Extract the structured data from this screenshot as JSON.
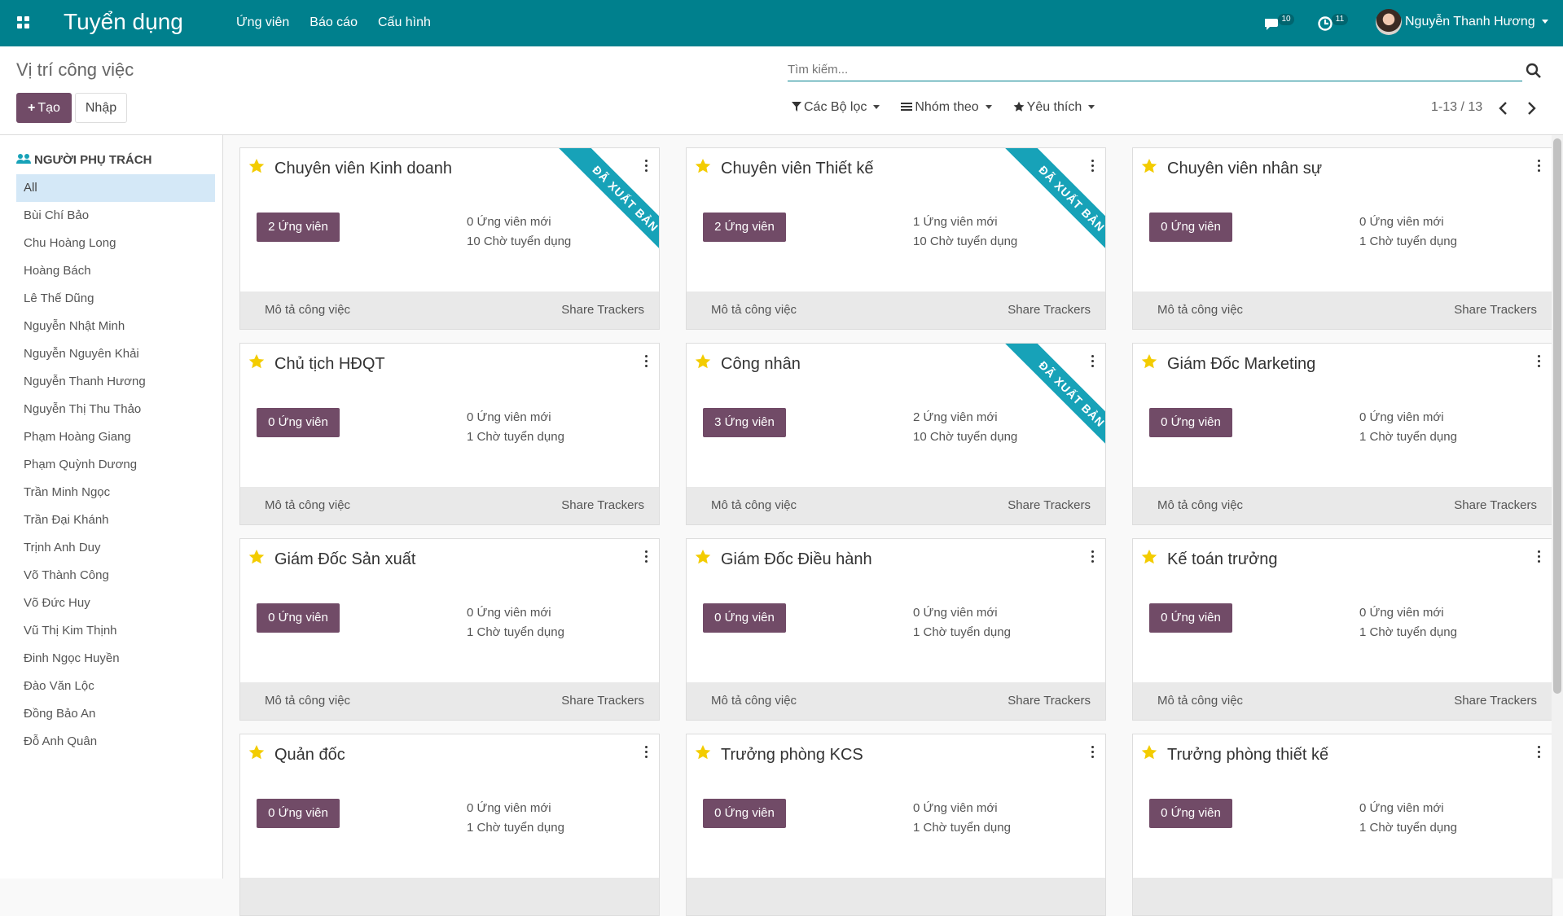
{
  "navbar": {
    "app_title": "Tuyển dụng",
    "menu": [
      "Ứng viên",
      "Báo cáo",
      "Cấu hình"
    ],
    "messages_count": "10",
    "activities_count": "11",
    "user_name": "Nguyễn Thanh Hương"
  },
  "control": {
    "page_title": "Vị trí công việc",
    "create_label": "Tạo",
    "import_label": "Nhập",
    "search_placeholder": "Tìm kiếm...",
    "filters_label": "Các Bộ lọc",
    "groupby_label": "Nhóm theo",
    "favorites_label": "Yêu thích",
    "pager": "1-13 / 13"
  },
  "sidebar": {
    "heading": "NGƯỜI PHỤ TRÁCH",
    "items": [
      "All",
      "Bùi Chí Bảo",
      "Chu Hoàng Long",
      "Hoàng Bách",
      "Lê Thế Dũng",
      "Nguyễn Nhật Minh",
      "Nguyễn Nguyên Khải",
      "Nguyễn Thanh Hương",
      "Nguyễn Thị Thu Thảo",
      "Phạm Hoàng Giang",
      "Phạm Quỳnh Dương",
      "Trần Minh Ngọc",
      "Trần Đại Khánh",
      "Trịnh Anh Duy",
      "Võ Thành Công",
      "Võ Đức Huy",
      "Vũ Thị Kim Thịnh",
      "Đinh Ngọc Huyền",
      "Đào Văn Lộc",
      "Đồng Bảo An",
      "Đỗ Anh Quân"
    ]
  },
  "cards": [
    {
      "title": "Chuyên viên Kinh doanh",
      "applicants": "2 Ứng viên",
      "new": "0 Ứng viên mới",
      "to_recruit": "10 Chờ tuyển dụng",
      "ribbon": "ĐÃ XUẤT BẢN",
      "desc": "Mô tả công việc",
      "share": "Share Trackers"
    },
    {
      "title": "Chuyên viên Thiết kế",
      "applicants": "2 Ứng viên",
      "new": "1 Ứng viên mới",
      "to_recruit": "10 Chờ tuyển dụng",
      "ribbon": "ĐÃ XUẤT BẢN",
      "desc": "Mô tả công việc",
      "share": "Share Trackers"
    },
    {
      "title": "Chuyên viên nhân sự",
      "applicants": "0 Ứng viên",
      "new": "0 Ứng viên mới",
      "to_recruit": "1 Chờ tuyển dụng",
      "ribbon": "",
      "desc": "Mô tả công việc",
      "share": "Share Trackers"
    },
    {
      "title": "Chủ tịch HĐQT",
      "applicants": "0 Ứng viên",
      "new": "0 Ứng viên mới",
      "to_recruit": "1 Chờ tuyển dụng",
      "ribbon": "",
      "desc": "Mô tả công việc",
      "share": "Share Trackers"
    },
    {
      "title": "Công nhân",
      "applicants": "3 Ứng viên",
      "new": "2 Ứng viên mới",
      "to_recruit": "10 Chờ tuyển dụng",
      "ribbon": "ĐÃ XUẤT BẢN",
      "desc": "Mô tả công việc",
      "share": "Share Trackers"
    },
    {
      "title": "Giám Đốc Marketing",
      "applicants": "0 Ứng viên",
      "new": "0 Ứng viên mới",
      "to_recruit": "1 Chờ tuyển dụng",
      "ribbon": "",
      "desc": "Mô tả công việc",
      "share": "Share Trackers"
    },
    {
      "title": "Giám Đốc Sản xuất",
      "applicants": "0 Ứng viên",
      "new": "0 Ứng viên mới",
      "to_recruit": "1 Chờ tuyển dụng",
      "ribbon": "",
      "desc": "Mô tả công việc",
      "share": "Share Trackers"
    },
    {
      "title": "Giám Đốc Điều hành",
      "applicants": "0 Ứng viên",
      "new": "0 Ứng viên mới",
      "to_recruit": "1 Chờ tuyển dụng",
      "ribbon": "",
      "desc": "Mô tả công việc",
      "share": "Share Trackers"
    },
    {
      "title": "Kế toán trưởng",
      "applicants": "0 Ứng viên",
      "new": "0 Ứng viên mới",
      "to_recruit": "1 Chờ tuyển dụng",
      "ribbon": "",
      "desc": "Mô tả công việc",
      "share": "Share Trackers"
    },
    {
      "title": "Quản đốc",
      "applicants": "0 Ứng viên",
      "new": "0 Ứng viên mới",
      "to_recruit": "1 Chờ tuyển dụng",
      "ribbon": "",
      "desc": "",
      "share": ""
    },
    {
      "title": "Trưởng phòng KCS",
      "applicants": "0 Ứng viên",
      "new": "0 Ứng viên mới",
      "to_recruit": "1 Chờ tuyển dụng",
      "ribbon": "",
      "desc": "",
      "share": ""
    },
    {
      "title": "Trưởng phòng thiết kế",
      "applicants": "0 Ứng viên",
      "new": "0 Ứng viên mới",
      "to_recruit": "1 Chờ tuyển dụng",
      "ribbon": "",
      "desc": "",
      "share": ""
    }
  ],
  "colors": {
    "navbar": "#00808d",
    "primary": "#714b67",
    "ribbon": "#17a2b8",
    "star": "#f3cc00"
  }
}
